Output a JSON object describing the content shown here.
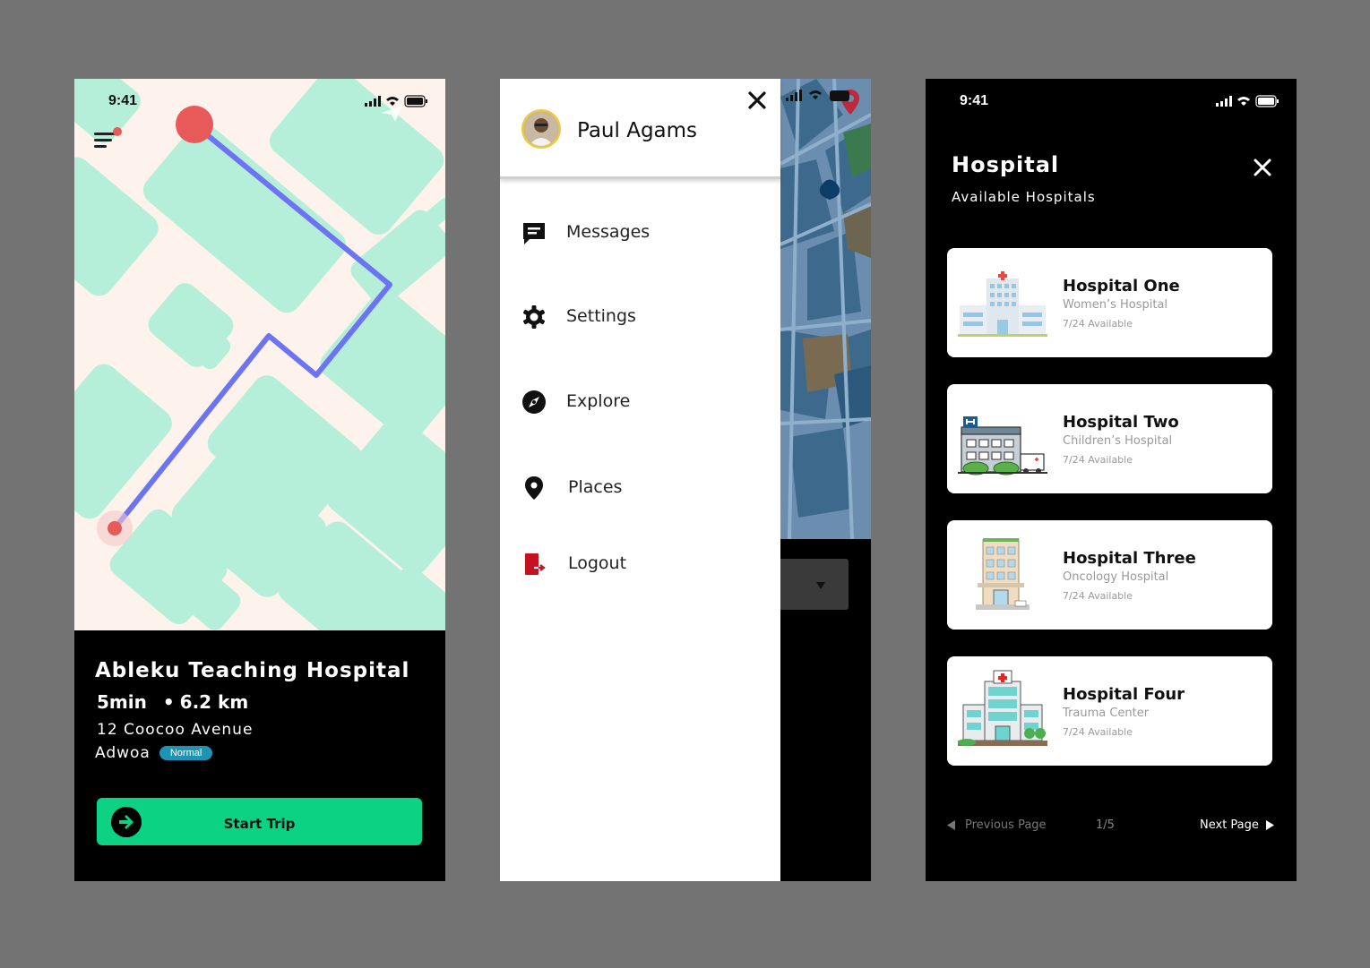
{
  "screen1": {
    "status_time": "9:41",
    "hospital_name": "Ableku Teaching Hospital",
    "duration": "5min",
    "separator": "•",
    "distance": "6.2 km",
    "address": "12 Coocoo Avenue",
    "driver_name": "Adwoa",
    "badge": "Normal",
    "start_button": "Start Trip",
    "colors": {
      "map_block": "#b5efd9",
      "route": "#6c74f2",
      "marker": "#e85959",
      "button": "#0cd384"
    }
  },
  "screen2": {
    "user_name": "Paul Agams",
    "menu": [
      {
        "label": "Messages",
        "icon": "message-icon"
      },
      {
        "label": "Settings",
        "icon": "gear-icon"
      },
      {
        "label": "Explore",
        "icon": "compass-icon"
      },
      {
        "label": "Places",
        "icon": "location-pin-icon"
      },
      {
        "label": "Logout",
        "icon": "logout-icon"
      }
    ]
  },
  "screen3": {
    "status_time": "9:41",
    "title": "Hospital",
    "subtitle": "Available Hospitals",
    "hospitals": [
      {
        "name": "Hospital One",
        "type": "Women’s Hospital",
        "availability": "7/24 Available"
      },
      {
        "name": "Hospital Two",
        "type": "Children’s Hospital",
        "availability": "7/24 Available"
      },
      {
        "name": "Hospital Three",
        "type": "Oncology Hospital",
        "availability": "7/24 Available"
      },
      {
        "name": "Hospital Four",
        "type": "Trauma Center",
        "availability": "7/24 Available"
      }
    ],
    "pager": {
      "prev": "Previous Page",
      "page": "1/5",
      "next": "Next Page"
    }
  }
}
